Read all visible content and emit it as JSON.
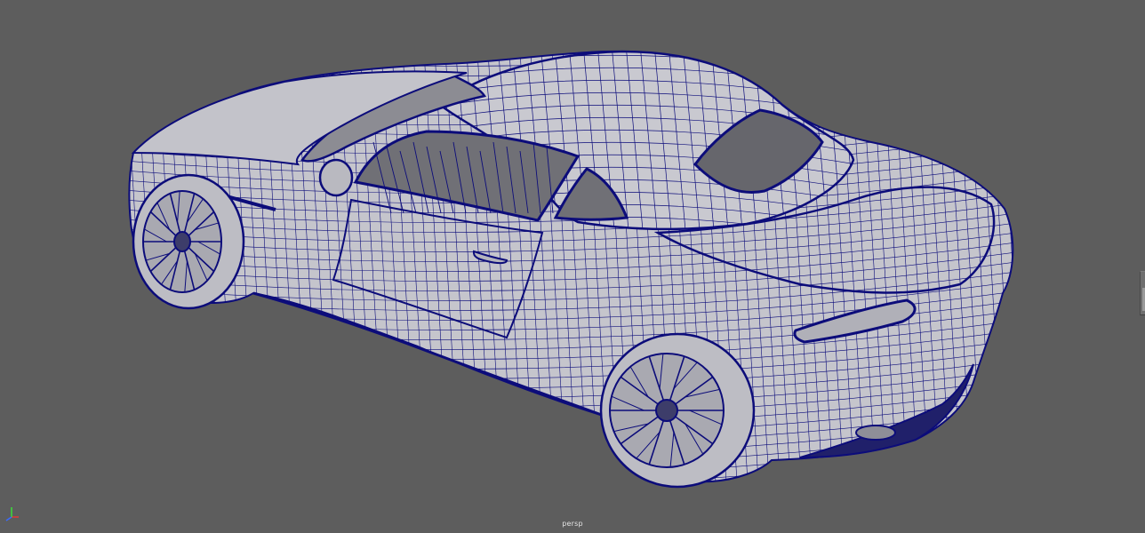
{
  "viewport": {
    "camera_name": "persp",
    "background_color": "#5d5d5d",
    "wire_color": "#0c0c7a",
    "surface_color": "#c5c5cc",
    "glass_color": "#66666c"
  },
  "model": {
    "icon": "wireframe-car-mesh"
  },
  "axis_gizmo": {
    "icon": "axis-gizmo-icon",
    "x_color": "#e23a3a",
    "y_color": "#3adf3a",
    "z_color": "#3a6bff"
  },
  "side_panel": {
    "icon": "panel-collapse-handle"
  }
}
